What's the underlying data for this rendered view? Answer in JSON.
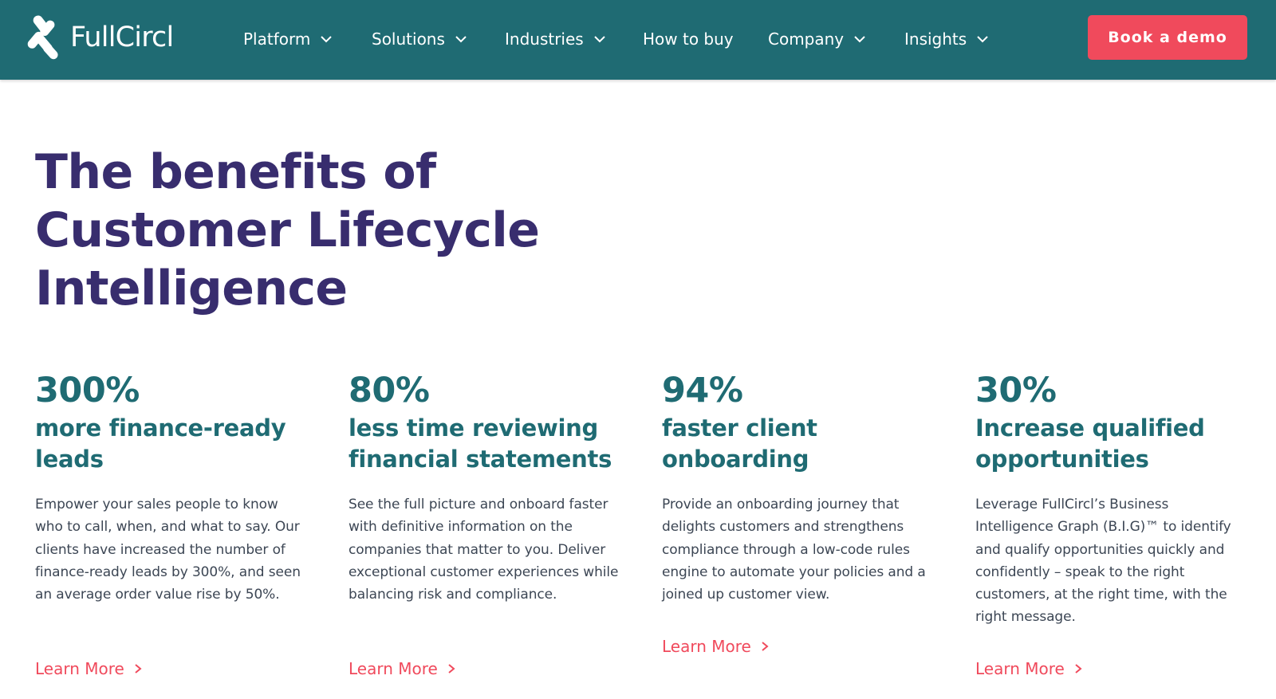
{
  "header": {
    "logo_text": "FullCircl",
    "nav": [
      {
        "label": "Platform",
        "has_dropdown": true
      },
      {
        "label": "Solutions",
        "has_dropdown": true
      },
      {
        "label": "Industries",
        "has_dropdown": true
      },
      {
        "label": "How to buy",
        "has_dropdown": false
      },
      {
        "label": "Company",
        "has_dropdown": true
      },
      {
        "label": "Insights",
        "has_dropdown": true
      }
    ],
    "cta_label": "Book a demo"
  },
  "hero": {
    "title_lines": [
      "The benefits of",
      "Customer Lifecycle",
      "Intelligence"
    ]
  },
  "benefits": [
    {
      "stat": "300%",
      "label_lines": [
        "more finance-ready",
        "leads"
      ],
      "description": "Empower your sales people to know who to call, when, and what to say. Our clients have increased the number of finance-ready leads by 300%, and seen an average order value rise by 50%.",
      "link": "Learn More"
    },
    {
      "stat": "80%",
      "label_lines": [
        "less time reviewing",
        "financial statements"
      ],
      "description": "See the full picture and onboard faster with definitive information on the companies that matter to you. Deliver exceptional customer experiences while balancing risk and compliance.",
      "link": "Learn More"
    },
    {
      "stat": "94%",
      "label_lines": [
        "faster client",
        "onboarding"
      ],
      "description": "Provide an onboarding journey that delights customers and strengthens compliance through a low-code rules engine to automate your policies and a joined up customer view.",
      "link": "Learn More"
    },
    {
      "stat": "30%",
      "label_lines": [
        "Increase qualified",
        "opportunities"
      ],
      "description": "Leverage FullCircl’s Business Intelligence Graph (B.I.G)™ to identify and qualify opportunities quickly and confidently – speak to the right customers, at the right time, with the right message.",
      "link": "Learn More"
    }
  ],
  "icons": {
    "logo": "fullcircl-logo-mark",
    "nav_dropdown": "chevron-down-icon",
    "link_arrow": "chevron-right-icon"
  },
  "colors": {
    "header_bg": "#1f6b73",
    "cta_bg": "#f04a5c",
    "title": "#382d6e",
    "stat": "#1f6b73",
    "link": "#f04a5c"
  }
}
